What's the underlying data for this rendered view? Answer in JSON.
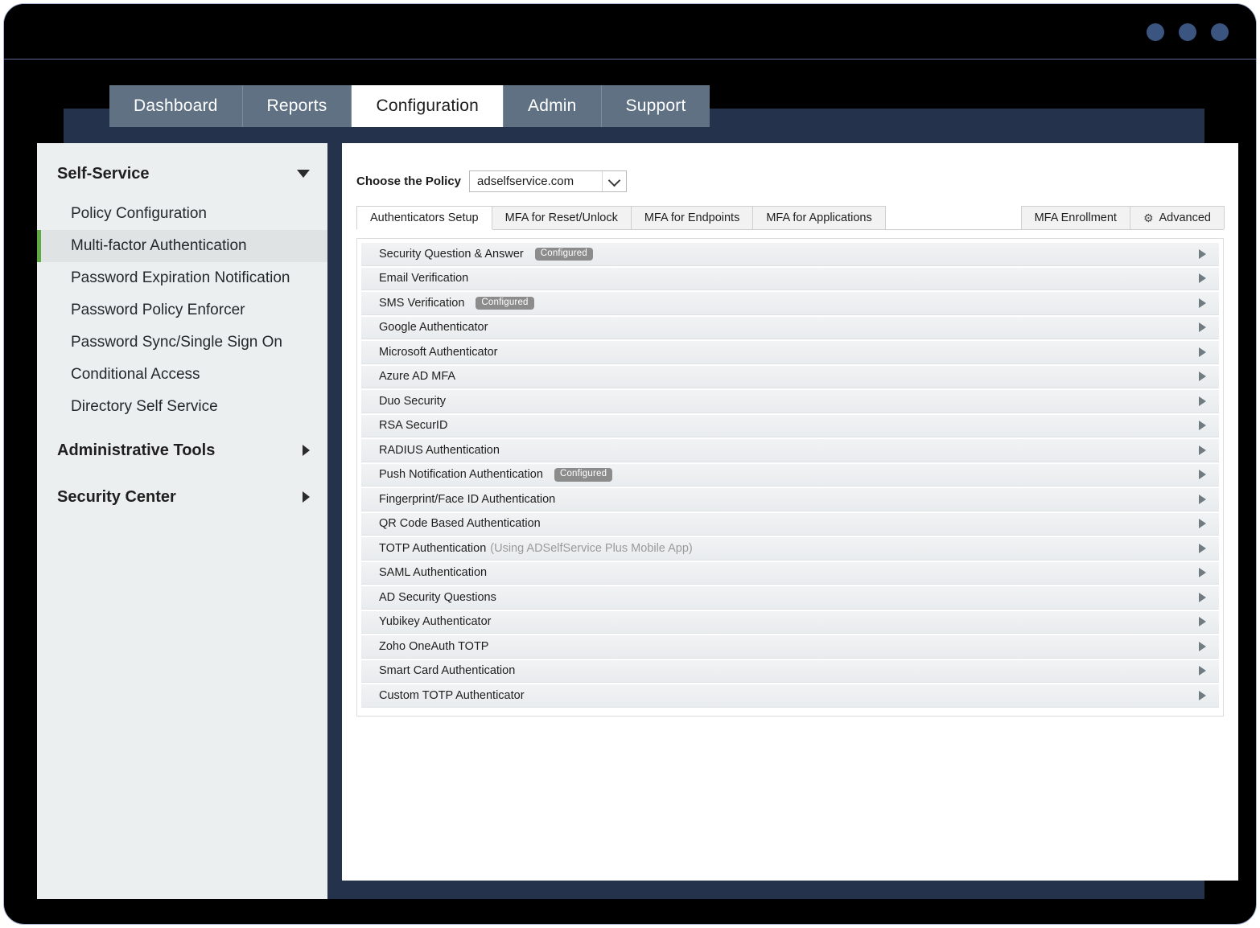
{
  "window": {
    "dots": [
      "minimize-dot",
      "maximize-dot",
      "close-dot"
    ]
  },
  "topnav": {
    "tabs": [
      {
        "label": "Dashboard",
        "active": false
      },
      {
        "label": "Reports",
        "active": false
      },
      {
        "label": "Configuration",
        "active": true
      },
      {
        "label": "Admin",
        "active": false
      },
      {
        "label": "Support",
        "active": false
      }
    ]
  },
  "sidebar": {
    "groups": [
      {
        "label": "Self-Service",
        "expanded": true,
        "items": [
          {
            "label": "Policy Configuration",
            "active": false
          },
          {
            "label": "Multi-factor Authentication",
            "active": true
          },
          {
            "label": "Password Expiration Notification",
            "active": false
          },
          {
            "label": "Password Policy Enforcer",
            "active": false
          },
          {
            "label": "Password Sync/Single Sign On",
            "active": false
          },
          {
            "label": "Conditional Access",
            "active": false
          },
          {
            "label": "Directory Self Service",
            "active": false
          }
        ]
      },
      {
        "label": "Administrative Tools",
        "expanded": false,
        "items": []
      },
      {
        "label": "Security Center",
        "expanded": false,
        "items": []
      }
    ]
  },
  "policy": {
    "label": "Choose the Policy",
    "selected": "adselfservice.com"
  },
  "tabs": {
    "left": [
      {
        "label": "Authenticators Setup",
        "active": true
      },
      {
        "label": "MFA for Reset/Unlock",
        "active": false
      },
      {
        "label": "MFA for Endpoints",
        "active": false
      },
      {
        "label": "MFA for Applications",
        "active": false
      }
    ],
    "right": [
      {
        "label": "MFA Enrollment",
        "icon": null
      },
      {
        "label": "Advanced",
        "icon": "gear-icon"
      }
    ]
  },
  "authenticators": [
    {
      "name": "Security Question & Answer",
      "note": "",
      "badge": "Configured"
    },
    {
      "name": "Email Verification",
      "note": "",
      "badge": ""
    },
    {
      "name": "SMS Verification",
      "note": "",
      "badge": "Configured"
    },
    {
      "name": "Google Authenticator",
      "note": "",
      "badge": ""
    },
    {
      "name": "Microsoft Authenticator",
      "note": "",
      "badge": ""
    },
    {
      "name": "Azure AD MFA",
      "note": "",
      "badge": ""
    },
    {
      "name": "Duo Security",
      "note": "",
      "badge": ""
    },
    {
      "name": "RSA SecurID",
      "note": "",
      "badge": ""
    },
    {
      "name": "RADIUS Authentication",
      "note": "",
      "badge": ""
    },
    {
      "name": "Push Notification Authentication",
      "note": "",
      "badge": "Configured"
    },
    {
      "name": "Fingerprint/Face ID Authentication",
      "note": "",
      "badge": ""
    },
    {
      "name": "QR Code Based Authentication",
      "note": "",
      "badge": ""
    },
    {
      "name": "TOTP Authentication",
      "note": "(Using ADSelfService Plus Mobile App)",
      "badge": ""
    },
    {
      "name": "SAML Authentication",
      "note": "",
      "badge": ""
    },
    {
      "name": "AD Security Questions",
      "note": "",
      "badge": ""
    },
    {
      "name": "Yubikey Authenticator",
      "note": "",
      "badge": ""
    },
    {
      "name": "Zoho OneAuth TOTP",
      "note": "",
      "badge": ""
    },
    {
      "name": "Smart Card Authentication",
      "note": "",
      "badge": ""
    },
    {
      "name": "Custom TOTP Authenticator",
      "note": "",
      "badge": ""
    }
  ],
  "colors": {
    "accent_green": "#5faa44",
    "app_navy": "#24324c",
    "nav_slate": "#5f7183",
    "badge_gray": "#8c8c8c",
    "window_dot": "#3c5480"
  }
}
